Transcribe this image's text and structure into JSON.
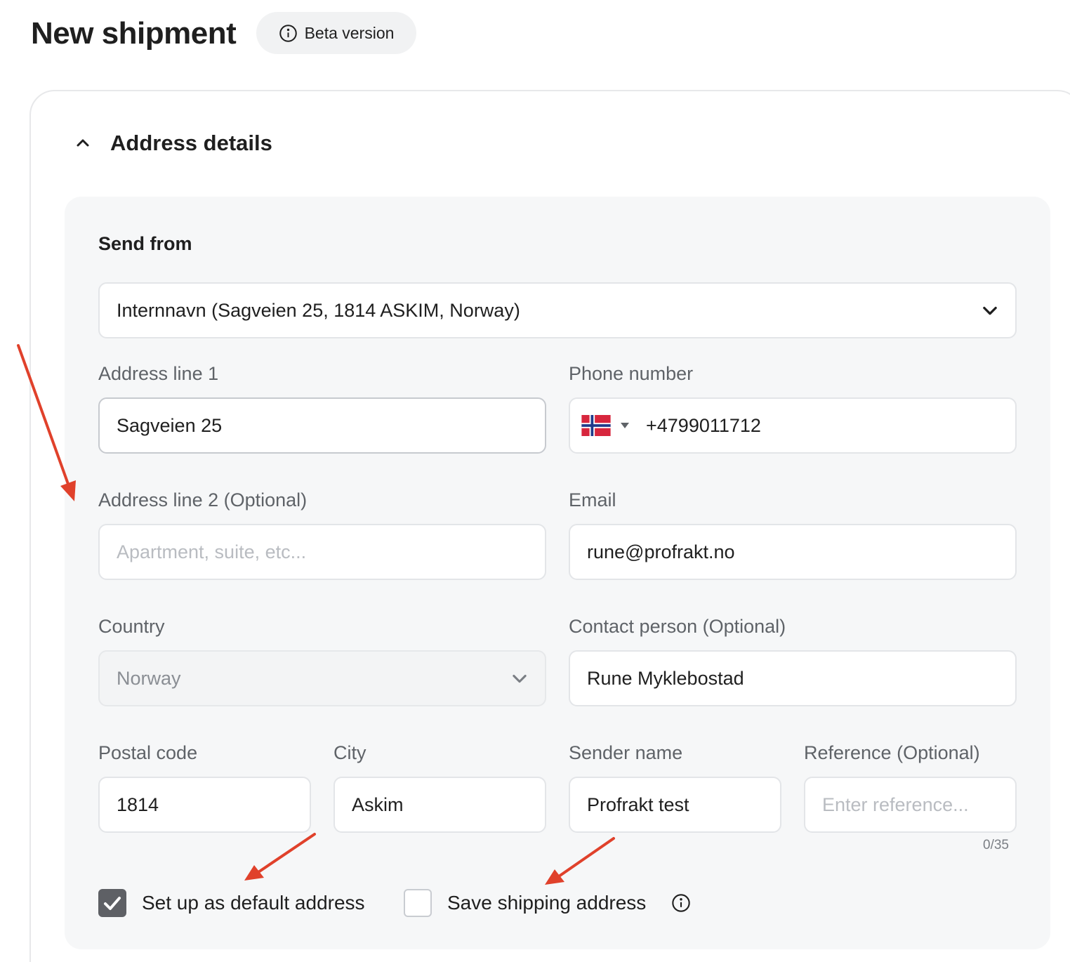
{
  "header": {
    "title": "New shipment",
    "beta_label": "Beta version"
  },
  "section": {
    "title": "Address details"
  },
  "send_from": {
    "label": "Send from",
    "selected": "Internnavn (Sagveien 25, 1814 ASKIM, Norway)"
  },
  "fields": {
    "address1": {
      "label": "Address line 1",
      "value": "Sagveien 25"
    },
    "phone": {
      "label": "Phone number",
      "value": "+4799011712",
      "country_flag": "norway-flag-icon"
    },
    "address2": {
      "label": "Address line 2 (Optional)",
      "placeholder": "Apartment, suite, etc..."
    },
    "email": {
      "label": "Email",
      "value": "rune@profrakt.no"
    },
    "country": {
      "label": "Country",
      "value": "Norway"
    },
    "contact": {
      "label": "Contact person (Optional)",
      "value": "Rune Myklebostad"
    },
    "postal": {
      "label": "Postal code",
      "value": "1814"
    },
    "city": {
      "label": "City",
      "value": "Askim"
    },
    "sender": {
      "label": "Sender name",
      "value": "Profrakt test"
    },
    "reference": {
      "label": "Reference (Optional)",
      "placeholder": "Enter reference...",
      "counter": "0/35"
    }
  },
  "checkboxes": {
    "default_address": {
      "label": "Set up as default address",
      "checked": true
    },
    "save_shipping": {
      "label": "Save shipping address",
      "checked": false
    }
  },
  "colors": {
    "annotation_arrow": "#e0412b",
    "checkbox_checked": "#5e6065",
    "panel_bg": "#f6f7f8"
  }
}
